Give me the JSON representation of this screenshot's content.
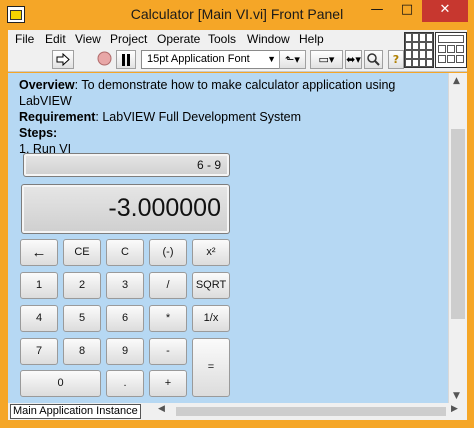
{
  "window": {
    "title": "Calculator [Main VI.vi] Front Panel",
    "minimize": "—",
    "maximize": "□",
    "close": "✕",
    "icon_label": "▸"
  },
  "menu": [
    "File",
    "Edit",
    "View",
    "Project",
    "Operate",
    "Tools",
    "Window",
    "Help"
  ],
  "toolbar": {
    "run_icon": "run-arrow-icon",
    "abort_icon": "abort-icon",
    "pause_icon": "pause-icon",
    "font": "15pt Application Font",
    "font_arrow": "▼",
    "align_glyph": "⬑▾",
    "distribute_glyph": "▭▾",
    "reorder_glyph": "⬌▾",
    "search_glyph": "🔍",
    "help_glyph": "?"
  },
  "description": {
    "overview_label": "Overview",
    "overview_text": ": To demonstrate how to make calculator application using LabVIEW",
    "requirement_label": "Requirement",
    "requirement_text": ": LabVIEW Full Development System",
    "steps_label": "Steps:",
    "step1": "1.  Run VI"
  },
  "calculator": {
    "expression": "6 - 9",
    "result": "-3.000000",
    "buttons": {
      "back": "←",
      "ce": "CE",
      "c": "C",
      "neg": "(-)",
      "sq": "x²",
      "b1": "1",
      "b2": "2",
      "b3": "3",
      "div": "/",
      "sqrt": "SQRT",
      "b4": "4",
      "b5": "5",
      "b6": "6",
      "mul": "*",
      "inv": "1/x",
      "b7": "7",
      "b8": "8",
      "b9": "9",
      "minus": "-",
      "eq": "=",
      "b0": "0",
      "dot": ".",
      "plus": "+"
    }
  },
  "status": {
    "context": "Main Application Instance"
  },
  "colors": {
    "panel_bg": "#b6d8f3",
    "title_bg": "#f5a627",
    "close_bg": "#c7372f"
  }
}
